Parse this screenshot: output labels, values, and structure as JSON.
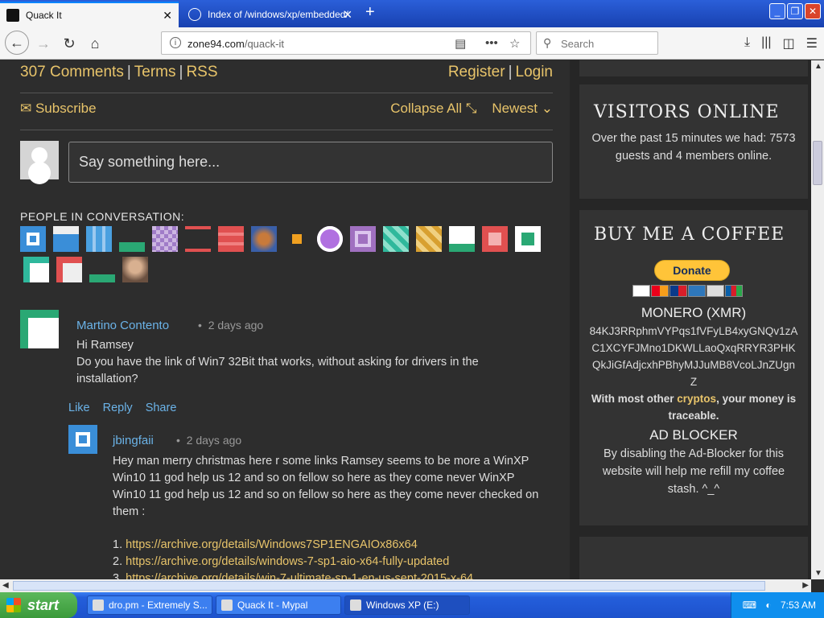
{
  "browser": {
    "tabs": [
      {
        "title": "Quack It",
        "active": true
      },
      {
        "title": "Index of /windows/xp/embedded/",
        "active": false
      }
    ],
    "url_host": "zone94.com",
    "url_path": "/quack-it",
    "search_placeholder": "Search"
  },
  "page": {
    "comments_count": "307 Comments",
    "terms": "Terms",
    "rss": "RSS",
    "register": "Register",
    "login": "Login",
    "subscribe": "Subscribe",
    "collapse_all": "Collapse All",
    "sort": "Newest",
    "say_placeholder": "Say something here...",
    "people_label": "PEOPLE IN CONVERSATION:",
    "comments": [
      {
        "author": "Martino Contento",
        "time": "2 days ago",
        "text1": "Hi Ramsey",
        "text2": "Do you have the link of Win7 32Bit that works, without asking for drivers in the installation?"
      },
      {
        "author": "jbingfaii",
        "time": "2 days ago",
        "text": "Hey man merry christmas here r some links Ramsey seems to be more a WinXP Win10 11 god help us 12 and so on fellow so here as they come never WinXP Win10 11 god help us 12 and so on fellow so here as they come never checked on them :",
        "links": [
          {
            "num": "1.",
            "url": "https://archive.org/details/Windows7SP1ENGAIOx86x64"
          },
          {
            "num": "2.",
            "url": "https://archive.org/details/windows-7-sp1-aio-x64-fully-updated"
          },
          {
            "num": "3.",
            "url": "https://archive.org/details/win-7-ultimate-sp-1-en-us-sept-2015-x-64"
          }
        ]
      }
    ],
    "actions": {
      "like": "Like",
      "reply": "Reply",
      "share": "Share"
    }
  },
  "sidebar": {
    "visitors_title": "VISITORS ONLINE",
    "visitors_text": "Over the past 15 minutes we had: 7573 guests and 4 members online.",
    "coffee_title": "BUY ME A COFFEE",
    "donate": "Donate",
    "monero_title": "MONERO (XMR)",
    "monero_address": "84KJ3RRphmVYPqs1fVFyLB4xyGNQv1zAC1XCYFJMno1DKWLLaoQxqRRYR3PHKQkJiGfAdjcxhPBhyMJJuMB8VcoLJnZUgnZ",
    "monero_note_pre": "With most other",
    "monero_note_link": "cryptos",
    "monero_note_post": ", your money is traceable.",
    "adblock_title": "AD BLOCKER",
    "adblock_text": "By disabling the Ad-Blocker for this website will help me refill my coffee stash. ^_^"
  },
  "taskbar": {
    "start": "start",
    "tasks": [
      "dro.pm - Extremely S...",
      "Quack It - Mypal",
      "Windows XP (E:)"
    ],
    "clock": "7:53 AM"
  },
  "colors": {
    "accent_yellow": "#e8c46a",
    "link_blue": "#6bb3e8",
    "background": "#2d2d2d"
  }
}
